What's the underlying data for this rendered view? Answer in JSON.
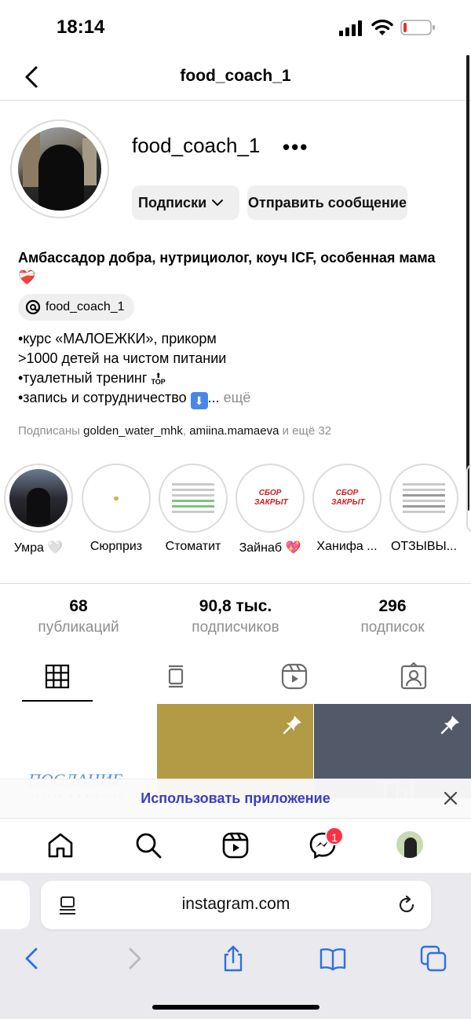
{
  "status_bar": {
    "time": "18:14"
  },
  "header": {
    "title": "food_coach_1"
  },
  "profile": {
    "username": "food_coach_1",
    "more": "•••",
    "follow_button": "Подписки",
    "message_button": "Отправить сообщение",
    "bio_title": "Амбассадор добра, нутрициолог, коуч ICF, особенная мама ❤️‍🩹",
    "threads_handle": "food_coach_1",
    "bio_lines": [
      "•курс «МАЛОЕЖКИ», прикорм",
      ">1000 детей на чистом питании",
      "•туалетный тренинг",
      "•запись и сотрудничество"
    ],
    "top_icon_text": "TOP",
    "bio_more": "ещё",
    "followed_prefix": "Подписаны",
    "followed_user1": "golden_water_mhk",
    "followed_user2": "amiina.mamaeva",
    "followed_suffix": "и ещё 32"
  },
  "highlights": [
    {
      "label": "Умра 🤍"
    },
    {
      "label": "Сюрприз"
    },
    {
      "label": "Стоматит"
    },
    {
      "label": "Зайнаб 💖",
      "cover_text": "СБОР ЗАКРЫТ"
    },
    {
      "label": "Ханифа ...",
      "cover_text": "СБОР ЗАКРЫТ"
    },
    {
      "label": "ОТЗЫВЫ..."
    }
  ],
  "stats": [
    {
      "value": "68",
      "label": "публикаций"
    },
    {
      "value": "90,8 тыс.",
      "label": "подписчиков"
    },
    {
      "value": "296",
      "label": "подписок"
    }
  ],
  "tabs": [
    "grid-icon",
    "feed-icon",
    "reels-icon",
    "tagged-icon"
  ],
  "grid": {
    "tile1_text": "ПОСЛАНИЕ ДЛЯ МАТЕР",
    "tile3_text": "ТЫ"
  },
  "app_banner": {
    "text": "Использовать приложение"
  },
  "bottom_nav": {
    "messages_badge": "1"
  },
  "safari": {
    "domain": "instagram.com"
  }
}
